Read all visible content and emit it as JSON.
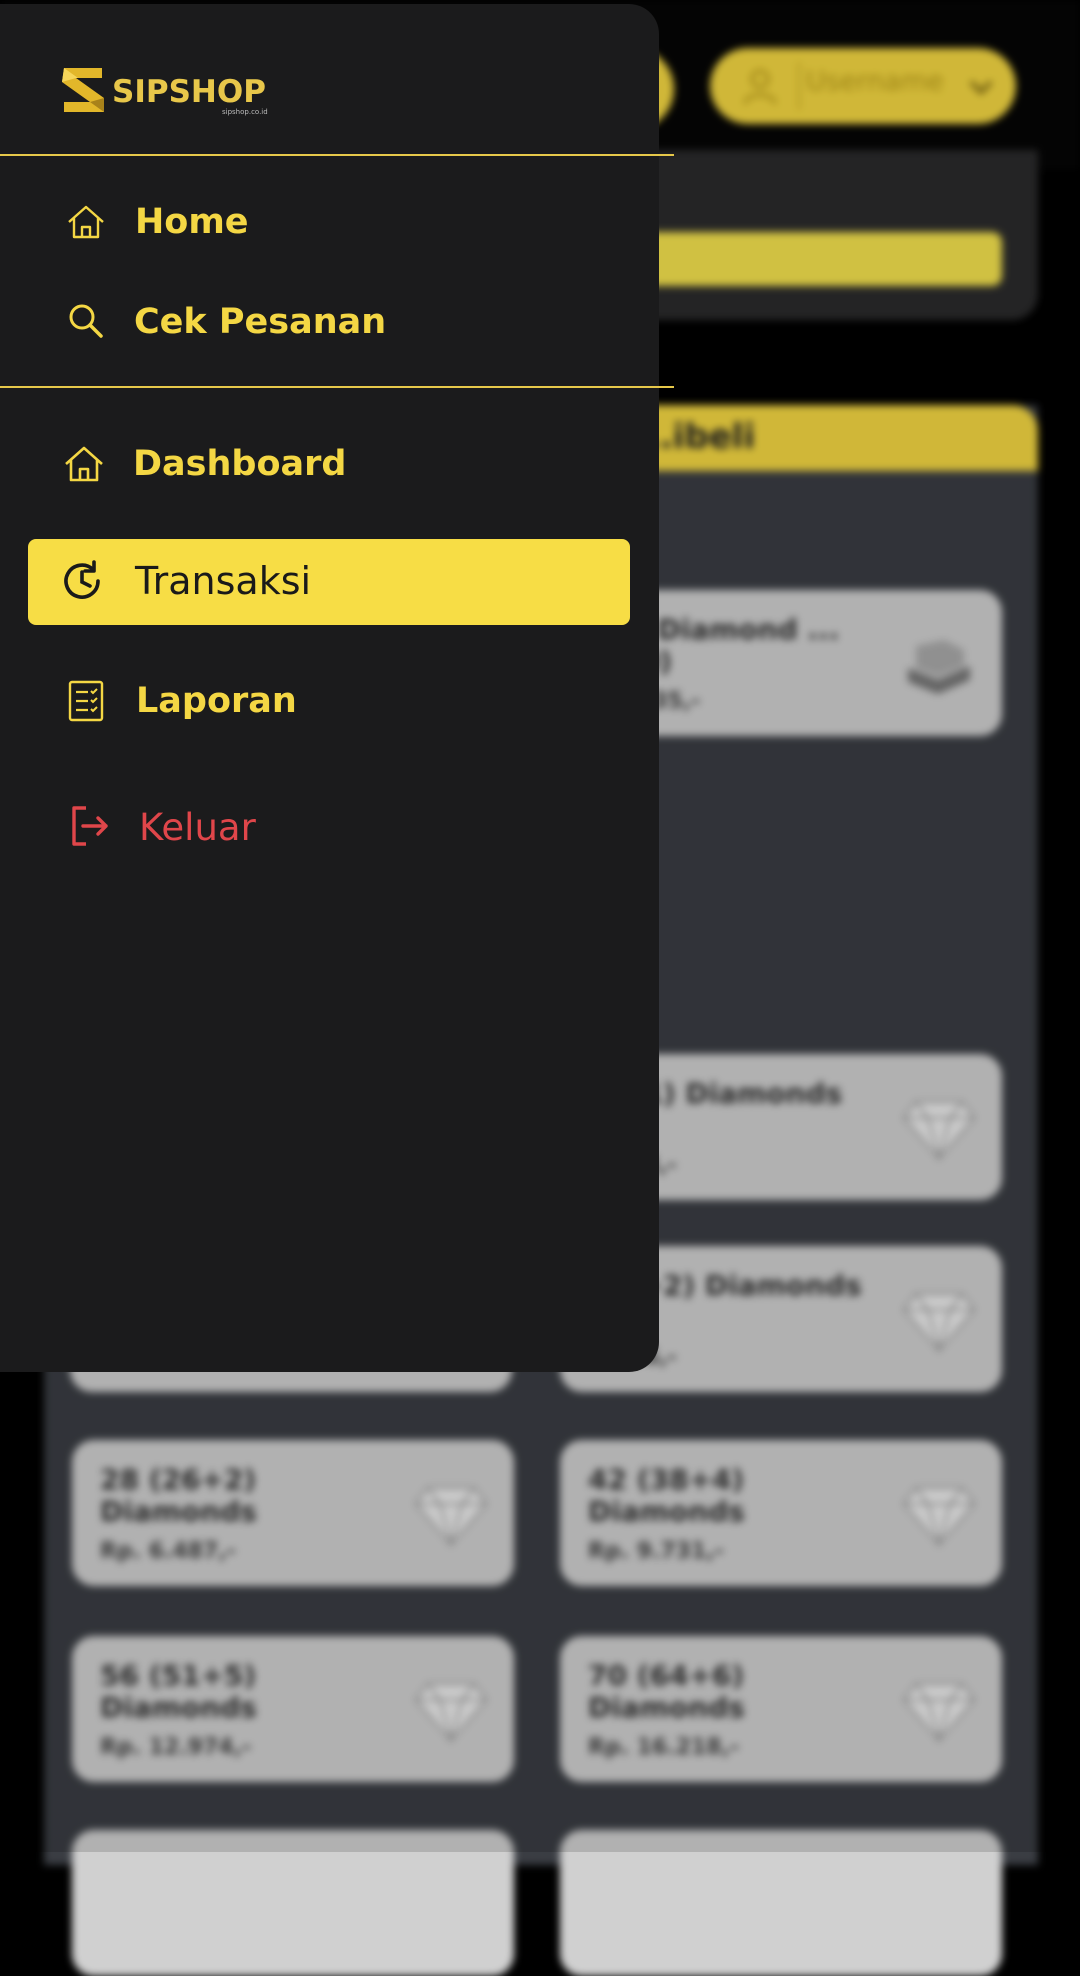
{
  "header": {
    "username": "Username"
  },
  "notice": {
    "line1": "...",
    "line2": ""
  },
  "section": {
    "title": "...ibeli"
  },
  "products": [
    {
      "name": "...ly Diamond ...(100)",
      "price": "...4.235,-",
      "icon": "chest-icon"
    },
    {
      "name": "...+1) Diamonds",
      "price": "...333,-",
      "icon": "diamond-icon"
    },
    {
      "name": "...7+2) Diamonds",
      "price": "...236,-",
      "icon": "diamond-icon"
    },
    {
      "name": "28 (26+2) Diamonds",
      "price": "Rp. 6.487,-",
      "icon": "diamond-icon"
    },
    {
      "name": "42 (38+4) Diamonds",
      "price": "Rp. 9.731,-",
      "icon": "diamond-icon"
    },
    {
      "name": "56 (51+5) Diamonds",
      "price": "Rp. 12.974,-",
      "icon": "diamond-icon"
    },
    {
      "name": "70 (64+6) Diamonds",
      "price": "Rp. 16.218,-",
      "icon": "diamond-icon"
    }
  ],
  "drawer": {
    "logo_text": "SIPSHOP",
    "logo_sub": "sipshop.co.id",
    "nav_top": [
      {
        "label": "Home",
        "icon": "home-icon"
      },
      {
        "label": "Cek Pesanan",
        "icon": "search-icon"
      }
    ],
    "nav_main": [
      {
        "label": "Dashboard",
        "icon": "home-icon"
      },
      {
        "label": "Transaksi",
        "icon": "history-icon",
        "active": true
      },
      {
        "label": "Laporan",
        "icon": "report-icon"
      },
      {
        "label": "Keluar",
        "icon": "logout-icon"
      }
    ]
  },
  "colors": {
    "accent": "#f4d744",
    "drawer_bg": "#1b1b1c",
    "danger": "#e0464a"
  }
}
